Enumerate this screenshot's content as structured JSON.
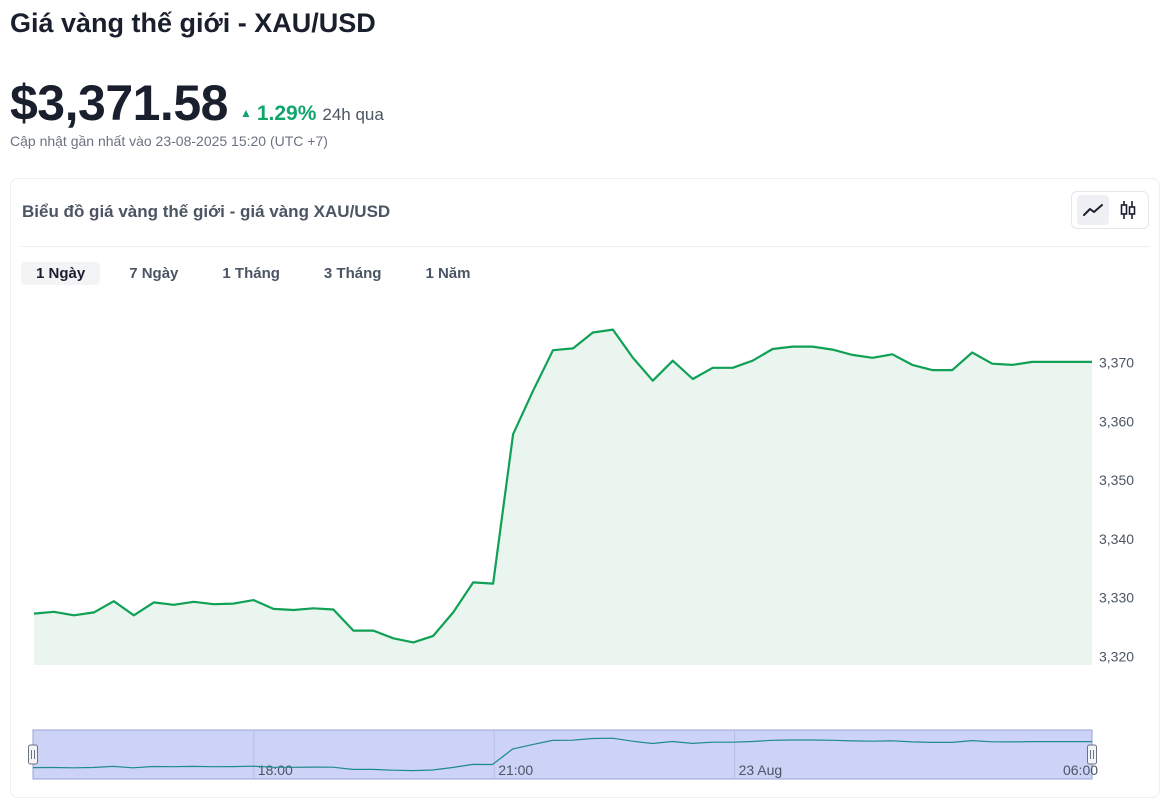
{
  "header": {
    "title": "Giá vàng thế giới - XAU/USD",
    "price": "$3,371.58",
    "change_pct": "1.29%",
    "change_period": "24h qua",
    "updated": "Cập nhật gần nhất vào 23-08-2025 15:20 (UTC +7)"
  },
  "card": {
    "title": "Biểu đồ giá vàng thế giới - giá vàng XAU/USD",
    "chart_types": [
      {
        "name": "line-chart-icon",
        "active": true
      },
      {
        "name": "candlestick-icon",
        "active": false
      }
    ]
  },
  "range_tabs": [
    {
      "label": "1 Ngày",
      "active": true
    },
    {
      "label": "7 Ngày",
      "active": false
    },
    {
      "label": "1 Tháng",
      "active": false
    },
    {
      "label": "3 Tháng",
      "active": false
    },
    {
      "label": "1 Năm",
      "active": false
    }
  ],
  "colors": {
    "line": "#10a056",
    "area": "#e9f5ee",
    "up": "#10a56a",
    "navigator_fill": "#cdd3f7",
    "navigator_line": "#1f8a8a"
  },
  "chart_data": {
    "type": "area",
    "title": "",
    "xlabel": "",
    "ylabel": "",
    "ylim": [
      3318.5,
      3376
    ],
    "yticks": [
      3320,
      3330,
      3340,
      3350,
      3360,
      3370
    ],
    "ytick_labels": [
      "3,320",
      "3,330",
      "3,340",
      "3,350",
      "3,360",
      "3,370"
    ],
    "series": [
      {
        "values": [
          3327.3,
          3327.6,
          3327.0,
          3327.5,
          3329.4,
          3327.0,
          3329.2,
          3328.8,
          3329.3,
          3328.9,
          3329.0,
          3329.6,
          3328.1,
          3327.9,
          3328.2,
          3328.0,
          3324.4,
          3324.4,
          3323.1,
          3322.4,
          3323.5,
          3327.5,
          3332.6,
          3332.4,
          3357.8,
          3365.2,
          3372.1,
          3372.4,
          3375.1,
          3375.6,
          3370.8,
          3366.9,
          3370.3,
          3367.2,
          3369.1,
          3369.1,
          3370.3,
          3372.3,
          3372.7,
          3372.7,
          3372.2,
          3371.3,
          3370.8,
          3371.4,
          3369.6,
          3368.7,
          3368.7,
          3371.7,
          3369.8,
          3369.6,
          3370.1,
          3370.1,
          3370.1,
          3370.1
        ]
      }
    ],
    "navigator": {
      "ticks": [
        "18:00",
        "21:00",
        "23 Aug",
        "06:00"
      ]
    }
  }
}
